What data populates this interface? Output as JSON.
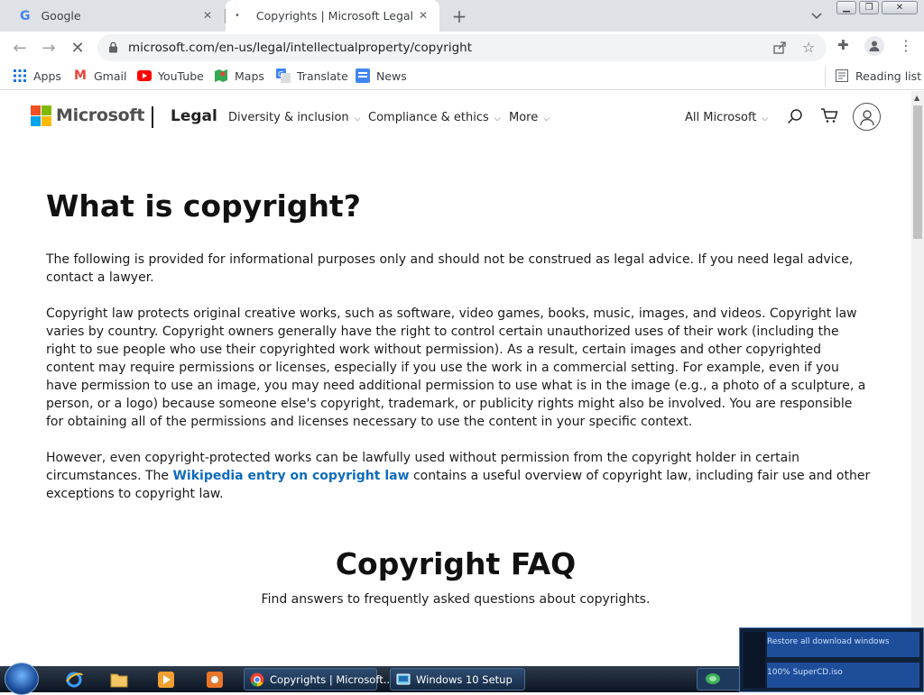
{
  "browser": {
    "tabs": [
      {
        "title": "Google",
        "active": false
      },
      {
        "title": "Copyrights | Microsoft Legal",
        "active": true
      }
    ],
    "url": "microsoft.com/en-us/legal/intellectualproperty/copyright",
    "bookmarks": [
      "Apps",
      "Gmail",
      "YouTube",
      "Maps",
      "Translate",
      "News"
    ],
    "reading_list": "Reading list"
  },
  "site": {
    "brand": "Microsoft",
    "section": "Legal",
    "nav": [
      "Diversity & inclusion",
      "Compliance & ethics",
      "More"
    ],
    "all_microsoft": "All Microsoft"
  },
  "content": {
    "heading": "What is copyright?",
    "p1": "The following is provided for informational purposes only and should not be construed as legal advice. If you need legal advice, contact a lawyer.",
    "p2": "Copyright law protects original creative works, such as software, video games, books, music, images, and videos. Copyright law varies by country. Copyright owners generally have the right to control certain unauthorized uses of their work (including the right to sue people who use their copyrighted work without permission). As a result, certain images and other copyrighted content may require permissions or licenses, especially if you use the work in a commercial setting. For example, even if you have permission to use an image, you may need additional permission to use what is in the image (e.g., a photo of a sculpture, a person, or a logo) because someone else's copyright, trademark, or publicity rights might also be involved. You are responsible for obtaining all of the permissions and licenses necessary to use the content in your specific context.",
    "p3_before": "However, even copyright-protected works can be lawfully used without permission from the copyright holder in certain circumstances. The ",
    "p3_link": "Wikipedia entry on copyright law",
    "p3_after": " contains a useful overview of copyright law, including fair use and other exceptions to copyright law.",
    "faq_title": "Copyright FAQ",
    "faq_subtitle": "Find answers to frequently asked questions about copyrights."
  },
  "taskbar": {
    "buttons": [
      "Copyrights | Microsoft...",
      "Windows 10 Setup"
    ]
  },
  "download_popup": {
    "row1": "Restore all download windows",
    "row2": "100% SuperCD.iso"
  },
  "colors": {
    "link": "#0f6cbd",
    "ms_red": "#f25022",
    "ms_green": "#7fba00",
    "ms_blue": "#00a4ef",
    "ms_yellow": "#ffb900"
  }
}
